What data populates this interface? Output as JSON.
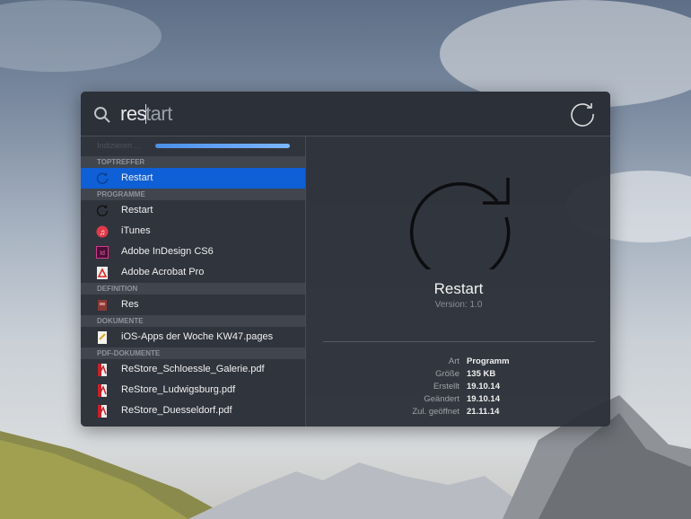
{
  "search": {
    "typed": "res",
    "completion": "tart",
    "status": "Indizieren ..."
  },
  "sections": [
    {
      "header": "TOPTREFFER",
      "items": [
        {
          "label": "Restart",
          "icon": "restart-icon",
          "selected": true
        }
      ]
    },
    {
      "header": "PROGRAMME",
      "items": [
        {
          "label": "Restart",
          "icon": "restart-icon"
        },
        {
          "label": "iTunes",
          "icon": "itunes-icon"
        },
        {
          "label": "Adobe InDesign CS6",
          "icon": "indesign-icon"
        },
        {
          "label": "Adobe Acrobat Pro",
          "icon": "acrobat-icon"
        }
      ]
    },
    {
      "header": "DEFINITION",
      "items": [
        {
          "label": "Res",
          "icon": "dictionary-icon"
        }
      ]
    },
    {
      "header": "DOKUMENTE",
      "items": [
        {
          "label": "iOS-Apps der Woche KW47.pages",
          "icon": "pages-doc-icon"
        }
      ]
    },
    {
      "header": "PDF-DOKUMENTE",
      "items": [
        {
          "label": "ReStore_Schloessle_Galerie.pdf",
          "icon": "pdf-icon"
        },
        {
          "label": "ReStore_Ludwigsburg.pdf",
          "icon": "pdf-icon"
        },
        {
          "label": "ReStore_Duesseldorf.pdf",
          "icon": "pdf-icon"
        }
      ]
    }
  ],
  "preview": {
    "title": "Restart",
    "version": "Version: 1.0",
    "details": [
      {
        "k": "Art",
        "v": "Programm"
      },
      {
        "k": "Größe",
        "v": "135 KB"
      },
      {
        "k": "Erstellt",
        "v": "19.10.14"
      },
      {
        "k": "Geändert",
        "v": "19.10.14"
      },
      {
        "k": "Zul. geöffnet",
        "v": "21.11.14"
      }
    ]
  },
  "colors": {
    "accent": "#0f5fd6"
  }
}
